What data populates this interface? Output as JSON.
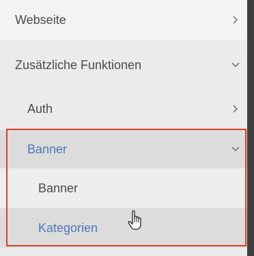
{
  "menu": {
    "items": [
      {
        "label": "Webseite",
        "icon": "chevron-right-icon"
      },
      {
        "label": "Zusätzliche Funktionen",
        "icon": "chevron-down-icon"
      },
      {
        "label": "Auth",
        "icon": "chevron-right-icon"
      },
      {
        "label": "Banner",
        "icon": "chevron-down-icon",
        "state": "expanded"
      },
      {
        "label": "Banner"
      },
      {
        "label": "Kategorien",
        "state": "hovered"
      }
    ]
  },
  "colors": {
    "active_text": "#4d7ab8",
    "highlight_border": "#d6402b"
  },
  "cursor": {
    "icon": "hand-pointer-icon"
  }
}
